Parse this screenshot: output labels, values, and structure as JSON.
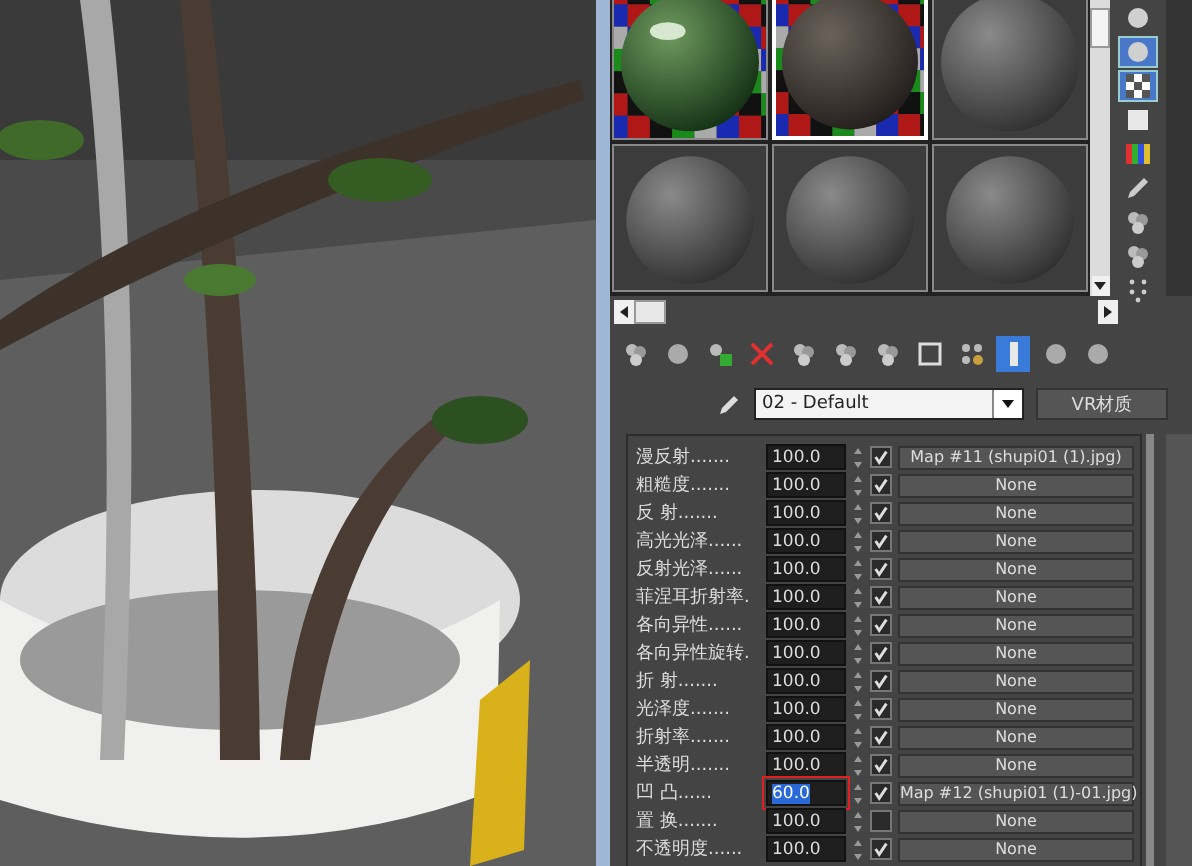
{
  "slots": [
    {
      "kind": "glossy",
      "selected": false
    },
    {
      "kind": "rough",
      "selected": true
    },
    {
      "kind": "plain",
      "selected": false
    },
    {
      "kind": "plain",
      "selected": false
    },
    {
      "kind": "plain",
      "selected": false
    },
    {
      "kind": "plain",
      "selected": false
    }
  ],
  "side_tools": [
    {
      "kind": "sphere",
      "selected": false
    },
    {
      "kind": "sphere",
      "selected": true
    },
    {
      "kind": "checker",
      "selected": true
    },
    {
      "kind": "square",
      "selected": false
    },
    {
      "kind": "bars",
      "selected": false
    },
    {
      "kind": "pencil",
      "selected": false
    },
    {
      "kind": "cluster",
      "selected": false
    },
    {
      "kind": "cluster",
      "selected": false
    },
    {
      "kind": "dots",
      "selected": false
    }
  ],
  "toolbar": [
    {
      "kind": "cluster",
      "selected": false
    },
    {
      "kind": "sphere",
      "selected": false
    },
    {
      "kind": "assign",
      "selected": false
    },
    {
      "kind": "delete",
      "selected": false
    },
    {
      "kind": "cluster",
      "selected": false
    },
    {
      "kind": "cluster",
      "selected": false
    },
    {
      "kind": "cluster",
      "selected": false
    },
    {
      "kind": "square",
      "selected": false
    },
    {
      "kind": "checker",
      "selected": false
    },
    {
      "kind": "bar",
      "selected": true
    },
    {
      "kind": "sphere",
      "selected": false
    },
    {
      "kind": "sphere",
      "selected": false
    }
  ],
  "material_name": "02 - Default",
  "material_type": "VR材质",
  "params": [
    {
      "label": "漫反射.......",
      "value": "100.0",
      "checked": true,
      "map": "Map #11 (shupi01 (1).jpg)",
      "selected": false
    },
    {
      "label": "粗糙度.......",
      "value": "100.0",
      "checked": true,
      "map": "None",
      "selected": false
    },
    {
      "label": "反 射.......",
      "value": "100.0",
      "checked": true,
      "map": "None",
      "selected": false
    },
    {
      "label": "高光光泽......",
      "value": "100.0",
      "checked": true,
      "map": "None",
      "selected": false
    },
    {
      "label": "反射光泽......",
      "value": "100.0",
      "checked": true,
      "map": "None",
      "selected": false
    },
    {
      "label": "菲涅耳折射率.",
      "value": "100.0",
      "checked": true,
      "map": "None",
      "selected": false
    },
    {
      "label": "各向异性......",
      "value": "100.0",
      "checked": true,
      "map": "None",
      "selected": false
    },
    {
      "label": "各向异性旋转.",
      "value": "100.0",
      "checked": true,
      "map": "None",
      "selected": false
    },
    {
      "label": "折 射.......",
      "value": "100.0",
      "checked": true,
      "map": "None",
      "selected": false
    },
    {
      "label": "光泽度.......",
      "value": "100.0",
      "checked": true,
      "map": "None",
      "selected": false
    },
    {
      "label": "折射率.......",
      "value": "100.0",
      "checked": true,
      "map": "None",
      "selected": false
    },
    {
      "label": "半透明.......",
      "value": "100.0",
      "checked": true,
      "map": "None",
      "selected": false
    },
    {
      "label": "凹 凸......",
      "value": "60.0",
      "checked": true,
      "map": "Map #12 (shupi01 (1)-01.jpg)",
      "selected": true
    },
    {
      "label": "置 换.......",
      "value": "100.0",
      "checked": false,
      "map": "None",
      "selected": false
    },
    {
      "label": "不透明度......",
      "value": "100.0",
      "checked": true,
      "map": "None",
      "selected": false
    }
  ]
}
